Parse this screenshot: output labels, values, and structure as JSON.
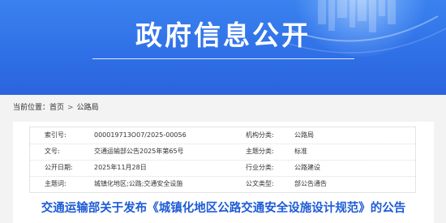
{
  "banner": {
    "title": "政府信息公开"
  },
  "breadcrumb": {
    "label": "当前位置：",
    "items": [
      "首页",
      "公路局"
    ],
    "separator": ">"
  },
  "info_table": {
    "rows": [
      {
        "label1": "索引号:",
        "value1": "000019713O07/2025-00056",
        "label2": "机构分类:",
        "value2": "公路局"
      },
      {
        "label1": "文号:",
        "value1": "交通运输部公告2025年第65号",
        "label2": "主题分类:",
        "value2": "标准"
      },
      {
        "label1": "公开日期:",
        "value1": "2025年11月28日",
        "label2": "行业分类:",
        "value2": "公路建设"
      },
      {
        "label1": "主题词:",
        "value1": "城镇化地区;公路;交通安全设施",
        "label2": "公文类型:",
        "value2": "部公告通告"
      }
    ]
  },
  "article": {
    "title": "交通运输部关于发布《城镇化地区公路交通安全设施设计规范》的公告"
  },
  "colors": {
    "banner": "#2f6fe6",
    "title_link": "#1d5bd6",
    "page_bg": "#f3f3f3"
  }
}
